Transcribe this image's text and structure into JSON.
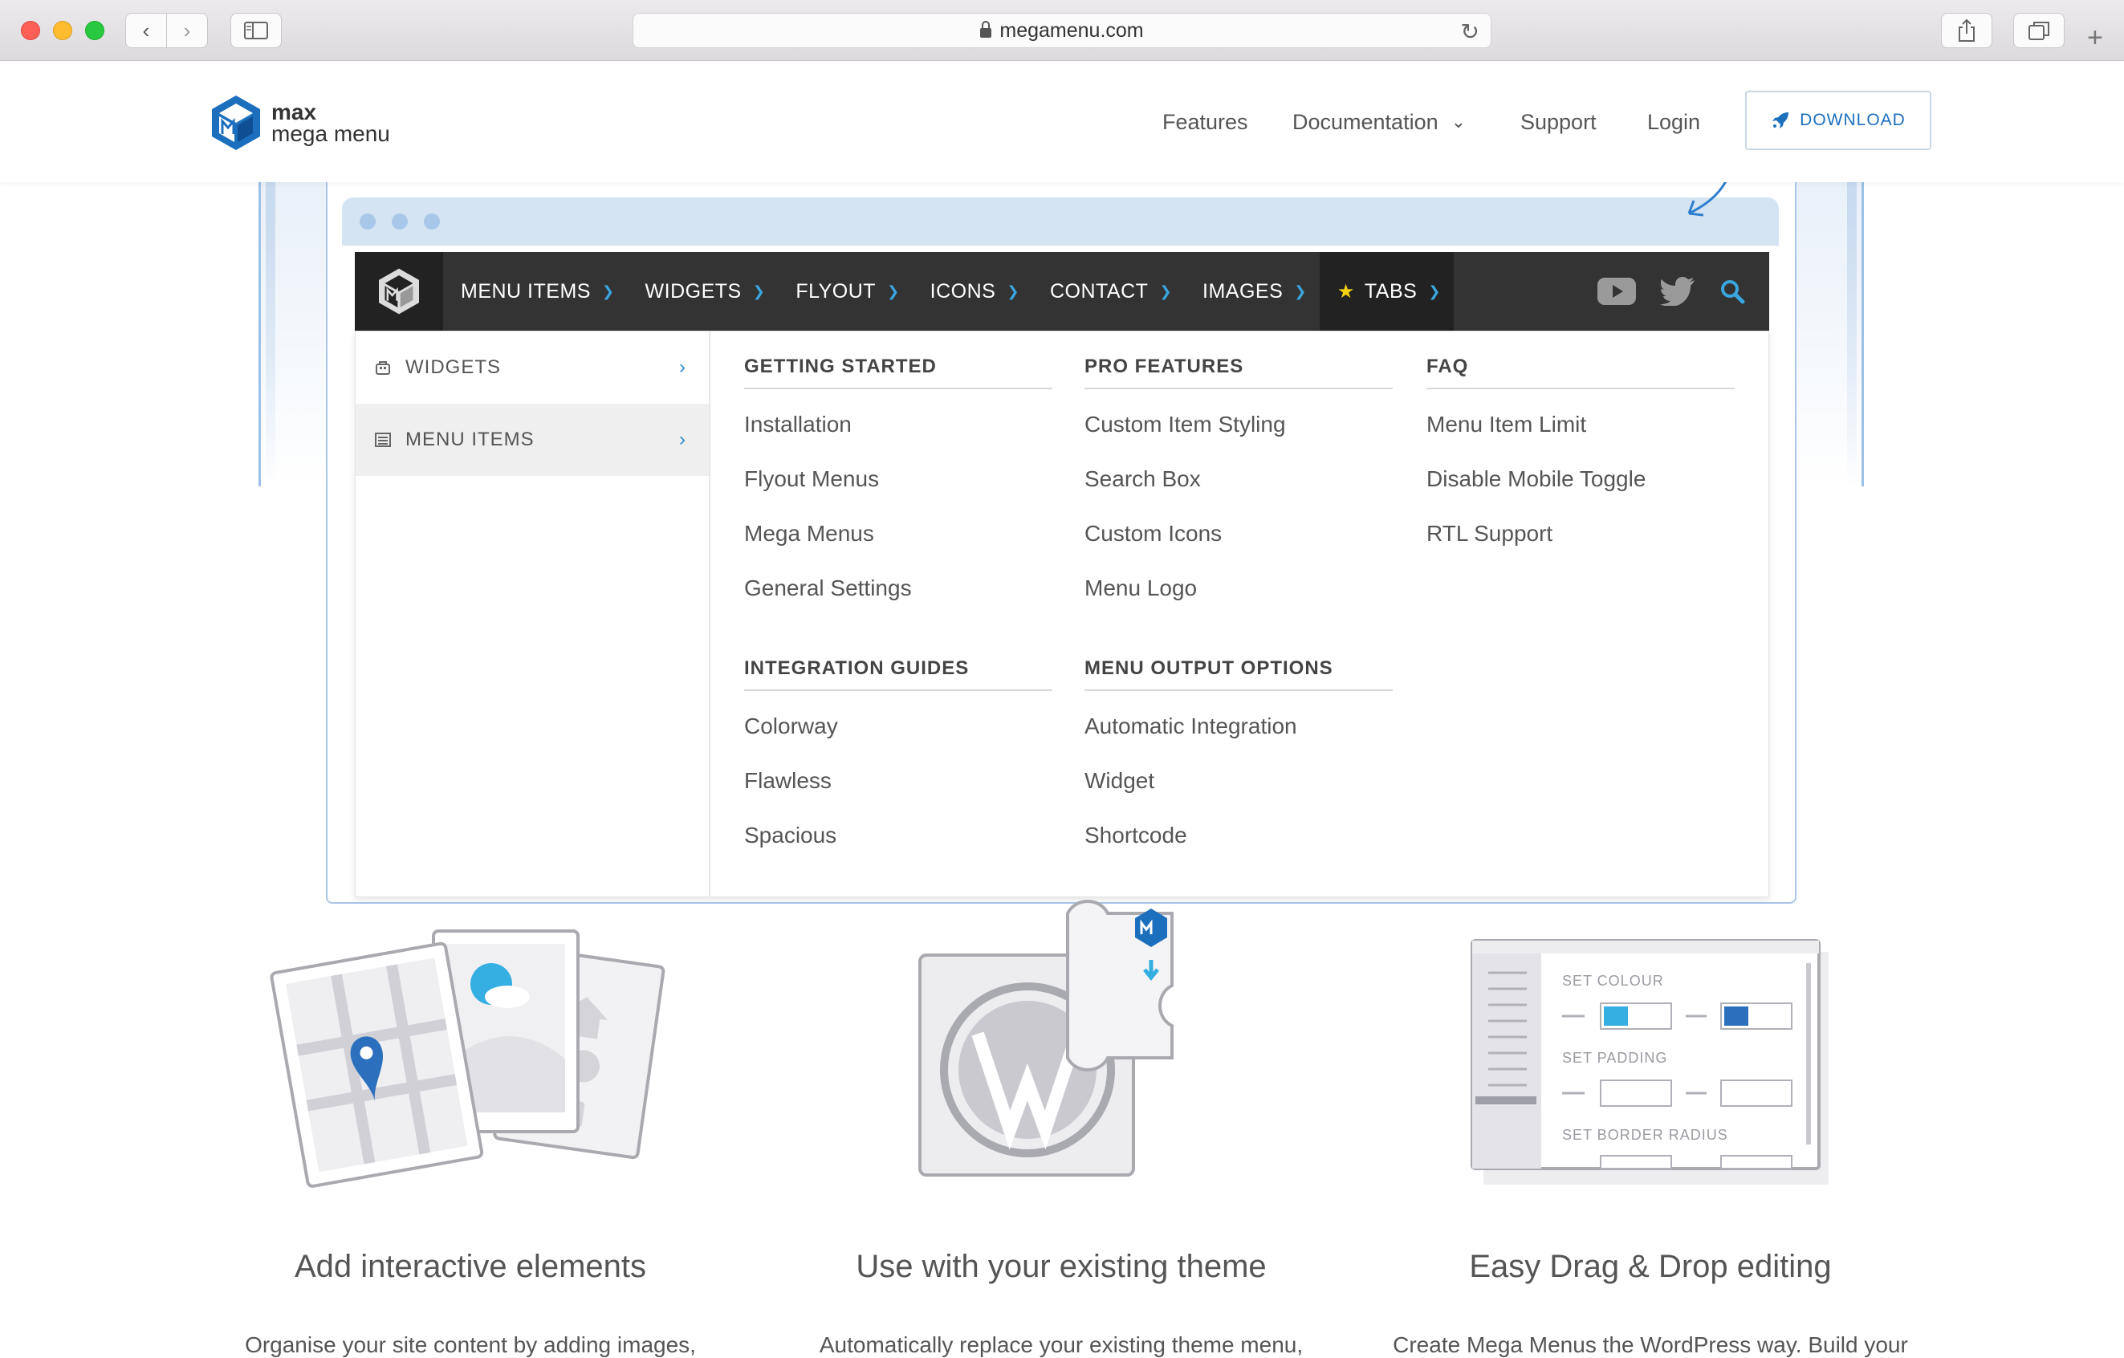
{
  "browser": {
    "url": "megamenu.com"
  },
  "site": {
    "logo_line1": "max",
    "logo_line2": "mega menu",
    "nav": {
      "features": "Features",
      "documentation": "Documentation",
      "support": "Support",
      "login": "Login",
      "download": "DOWNLOAD"
    }
  },
  "demo_menu": {
    "items": [
      {
        "label": "MENU ITEMS"
      },
      {
        "label": "WIDGETS"
      },
      {
        "label": "FLYOUT"
      },
      {
        "label": "ICONS"
      },
      {
        "label": "CONTACT"
      },
      {
        "label": "IMAGES"
      },
      {
        "label": "TABS"
      }
    ],
    "tabs": [
      {
        "label": "WIDGETS"
      },
      {
        "label": "MENU ITEMS"
      }
    ],
    "columns": [
      {
        "heading": "GETTING STARTED",
        "links": [
          "Installation",
          "Flyout Menus",
          "Mega Menus",
          "General Settings"
        ]
      },
      {
        "heading": "PRO FEATURES",
        "links": [
          "Custom Item Styling",
          "Search Box",
          "Custom Icons",
          "Menu Logo"
        ]
      },
      {
        "heading": "FAQ",
        "links": [
          "Menu Item Limit",
          "Disable Mobile Toggle",
          "RTL Support"
        ]
      },
      {
        "heading": "INTEGRATION GUIDES",
        "links": [
          "Colorway",
          "Flawless",
          "Spacious"
        ]
      },
      {
        "heading": "MENU OUTPUT OPTIONS",
        "links": [
          "Automatic Integration",
          "Widget",
          "Shortcode"
        ]
      }
    ]
  },
  "illustration_labels": {
    "set_colour": "SET COLOUR",
    "set_padding": "SET PADDING",
    "set_border_radius": "SET BORDER RADIUS"
  },
  "features": [
    {
      "title": "Add interactive elements",
      "desc": "Organise your site content by adding images,"
    },
    {
      "title": "Use with your existing theme",
      "desc": "Automatically replace your existing theme menu,"
    },
    {
      "title": "Easy Drag & Drop editing",
      "desc": "Create Mega Menus the WordPress way. Build your"
    }
  ],
  "colors": {
    "accent": "#1c6fbd",
    "menubar": "#333333",
    "chevron": "#3aa6e0",
    "star": "#f5d312"
  }
}
